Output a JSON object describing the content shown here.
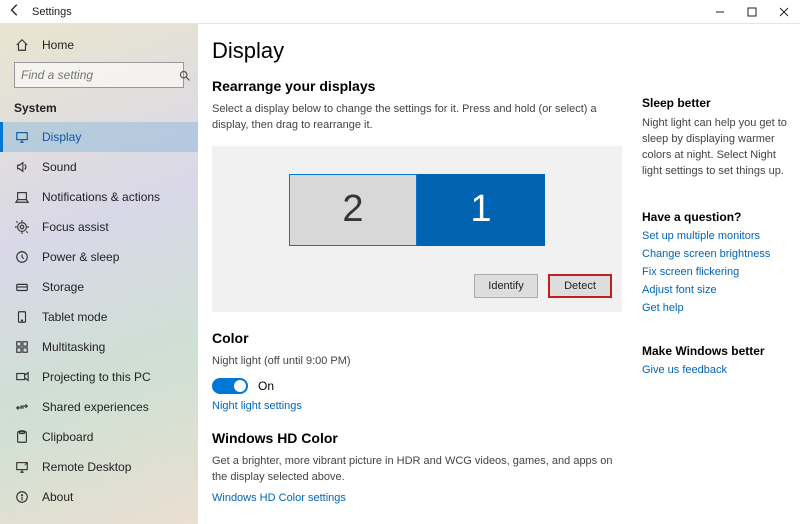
{
  "window": {
    "title": "Settings"
  },
  "sidebar": {
    "home": "Home",
    "search_placeholder": "Find a setting",
    "section": "System",
    "items": [
      {
        "label": "Display",
        "selected": true
      },
      {
        "label": "Sound"
      },
      {
        "label": "Notifications & actions"
      },
      {
        "label": "Focus assist"
      },
      {
        "label": "Power & sleep"
      },
      {
        "label": "Storage"
      },
      {
        "label": "Tablet mode"
      },
      {
        "label": "Multitasking"
      },
      {
        "label": "Projecting to this PC"
      },
      {
        "label": "Shared experiences"
      },
      {
        "label": "Clipboard"
      },
      {
        "label": "Remote Desktop"
      },
      {
        "label": "About"
      }
    ]
  },
  "main": {
    "title": "Display",
    "rearrange": {
      "heading": "Rearrange your displays",
      "desc": "Select a display below to change the settings for it. Press and hold (or select) a display, then drag to rearrange it.",
      "display2": "2",
      "display1": "1",
      "identify": "Identify",
      "detect": "Detect"
    },
    "color": {
      "heading": "Color",
      "night_light_status": "Night light (off until 9:00 PM)",
      "toggle_label": "On",
      "settings_link": "Night light settings"
    },
    "hd": {
      "heading": "Windows HD Color",
      "desc": "Get a brighter, more vibrant picture in HDR and WCG videos, games, and apps on the display selected above.",
      "link": "Windows HD Color settings"
    }
  },
  "aside": {
    "sleep": {
      "heading": "Sleep better",
      "desc": "Night light can help you get to sleep by displaying warmer colors at night. Select Night light settings to set things up."
    },
    "question": {
      "heading": "Have a question?",
      "links": [
        "Set up multiple monitors",
        "Change screen brightness",
        "Fix screen flickering",
        "Adjust font size",
        "Get help"
      ]
    },
    "feedback": {
      "heading": "Make Windows better",
      "link": "Give us feedback"
    }
  }
}
